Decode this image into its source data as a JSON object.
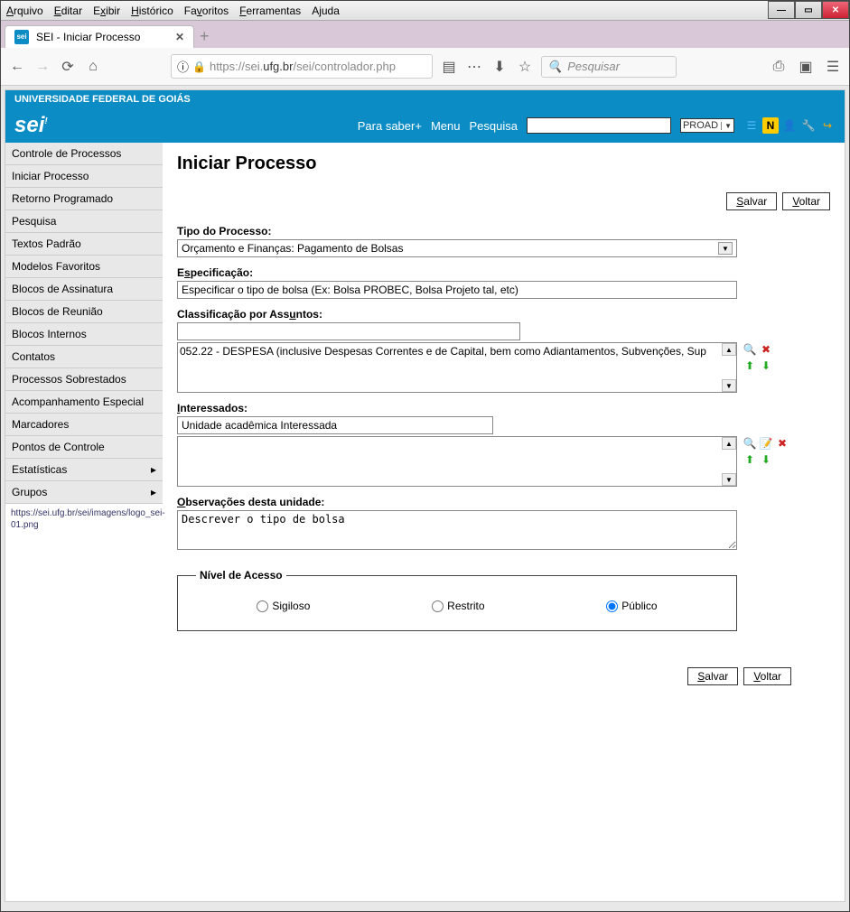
{
  "menubar": [
    {
      "label": "Arquivo",
      "u": "A"
    },
    {
      "label": "Editar",
      "u": "E"
    },
    {
      "label": "Exibir",
      "u": "x"
    },
    {
      "label": "Histórico",
      "u": "H"
    },
    {
      "label": "Favoritos",
      "u": "F"
    },
    {
      "label": "Ferramentas",
      "u": "F"
    },
    {
      "label": "Ajuda",
      "u": "j"
    }
  ],
  "tab": {
    "title": "SEI - Iniciar Processo"
  },
  "url": {
    "prefix": "https://sei.",
    "domain": "ufg.br",
    "suffix": "/sei/controlador.php"
  },
  "search": {
    "placeholder": "Pesquisar"
  },
  "sei": {
    "org": "UNIVERSIDADE FEDERAL DE GOIÁS",
    "logo": "sei!",
    "menu": {
      "parasaber": "Para saber+",
      "menu": "Menu",
      "pesquisa": "Pesquisa"
    },
    "unit": "PROAD"
  },
  "sidebar": {
    "items": [
      "Controle de Processos",
      "Iniciar Processo",
      "Retorno Programado",
      "Pesquisa",
      "Textos Padrão",
      "Modelos Favoritos",
      "Blocos de Assinatura",
      "Blocos de Reunião",
      "Blocos Internos",
      "Contatos",
      "Processos Sobrestados",
      "Acompanhamento Especial",
      "Marcadores",
      "Pontos de Controle"
    ],
    "expand_items": [
      "Estatísticas",
      "Grupos"
    ],
    "link": "https://sei.ufg.br/sei/imagens/logo_sei-01.png"
  },
  "page": {
    "title": "Iniciar Processo",
    "save": "Salvar",
    "back": "Voltar",
    "labels": {
      "tipo": "Tipo do Processo:",
      "espec": "Especificação:",
      "classif": "Classificação por Assuntos:",
      "inter": "Interessados:",
      "obs": "Observações desta unidade:",
      "nivel": "Nível de Acesso"
    },
    "tipo_value": "Orçamento e Finanças: Pagamento de Bolsas",
    "espec_value": "Especificar o tipo de bolsa (Ex: Bolsa PROBEC, Bolsa Projeto tal, etc)",
    "classif_item": "052.22 - DESPESA (inclusive Despesas Correntes e de Capital, bem como Adiantamentos, Subvenções, Sup",
    "inter_value": "Unidade acadêmica Interessada",
    "obs_value": "Descrever o tipo de bolsa",
    "radios": {
      "sigiloso": "Sigiloso",
      "restrito": "Restrito",
      "publico": "Público"
    }
  }
}
